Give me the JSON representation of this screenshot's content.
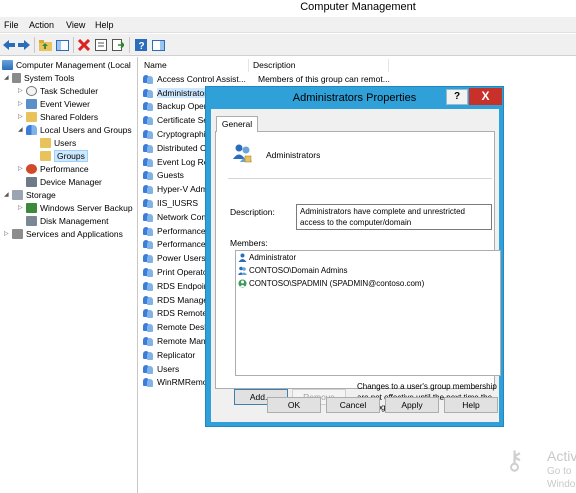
{
  "window": {
    "title": "Computer Management"
  },
  "menu": [
    "File",
    "Action",
    "View",
    "Help"
  ],
  "toolbar": {
    "icons": [
      "back-icon",
      "forward-icon",
      "up-folder-icon",
      "show-hide-tree-icon",
      "delete-icon",
      "properties-icon",
      "export-list-icon",
      "help-icon",
      "show-action-pane-icon"
    ]
  },
  "tree": {
    "root": "Computer Management (Local",
    "system_tools": "System Tools",
    "task_scheduler": "Task Scheduler",
    "event_viewer": "Event Viewer",
    "shared_folders": "Shared Folders",
    "local_users_groups": "Local Users and Groups",
    "users": "Users",
    "groups": "Groups",
    "performance": "Performance",
    "device_manager": "Device Manager",
    "storage": "Storage",
    "windows_server_backup": "Windows Server Backup",
    "disk_management": "Disk Management",
    "services_apps": "Services and Applications"
  },
  "list": {
    "col_name": "Name",
    "col_description": "Description",
    "rows": [
      {
        "name": "Access Control Assist...",
        "desc": "Members of this group can remot..."
      },
      {
        "name": "Administrators",
        "desc": ""
      },
      {
        "name": "Backup Operators",
        "desc": ""
      },
      {
        "name": "Certificate Service DCOM Access",
        "desc": ""
      },
      {
        "name": "Cryptographic Operators",
        "desc": ""
      },
      {
        "name": "Distributed COM Users",
        "desc": ""
      },
      {
        "name": "Event Log Readers",
        "desc": ""
      },
      {
        "name": "Guests",
        "desc": ""
      },
      {
        "name": "Hyper-V Administrators",
        "desc": ""
      },
      {
        "name": "IIS_IUSRS",
        "desc": ""
      },
      {
        "name": "Network Configuration Operators",
        "desc": ""
      },
      {
        "name": "Performance Log Users",
        "desc": ""
      },
      {
        "name": "Performance Monitor Users",
        "desc": ""
      },
      {
        "name": "Power Users",
        "desc": ""
      },
      {
        "name": "Print Operators",
        "desc": ""
      },
      {
        "name": "RDS Endpoint Servers",
        "desc": ""
      },
      {
        "name": "RDS Management Servers",
        "desc": ""
      },
      {
        "name": "RDS Remote Access Servers",
        "desc": ""
      },
      {
        "name": "Remote Desktop Users",
        "desc": ""
      },
      {
        "name": "Remote Management Users",
        "desc": ""
      },
      {
        "name": "Replicator",
        "desc": ""
      },
      {
        "name": "Users",
        "desc": ""
      },
      {
        "name": "WinRMRemoteWMIUsers__",
        "desc": ""
      }
    ]
  },
  "dialog": {
    "title": "Administrators Properties",
    "help_label": "?",
    "close_label": "X",
    "tab_general": "General",
    "group_name": "Administrators",
    "description_label": "Description:",
    "description_value": "Administrators have complete and unrestricted access to the computer/domain",
    "members_label": "Members:",
    "members": [
      {
        "name": "Administrator",
        "type": "user"
      },
      {
        "name": "CONTOSO\\Domain Admins",
        "type": "group"
      },
      {
        "name": "CONTOSO\\SPADMIN (SPADMIN@contoso.com)",
        "type": "user"
      }
    ],
    "add_label": "Add...",
    "remove_label": "Remove",
    "note": "Changes to a user's group membership are not effective until the next time the user logs on.",
    "ok_label": "OK",
    "cancel_label": "Cancel",
    "apply_label": "Apply",
    "help_button_label": "Help"
  },
  "watermark": {
    "line1": "Activ",
    "line2": "Go to",
    "line3": "Windo"
  },
  "colors": {
    "dialog_frame": "#2fa0d8",
    "close_red": "#c7312a",
    "selection": "#cde8ff"
  }
}
